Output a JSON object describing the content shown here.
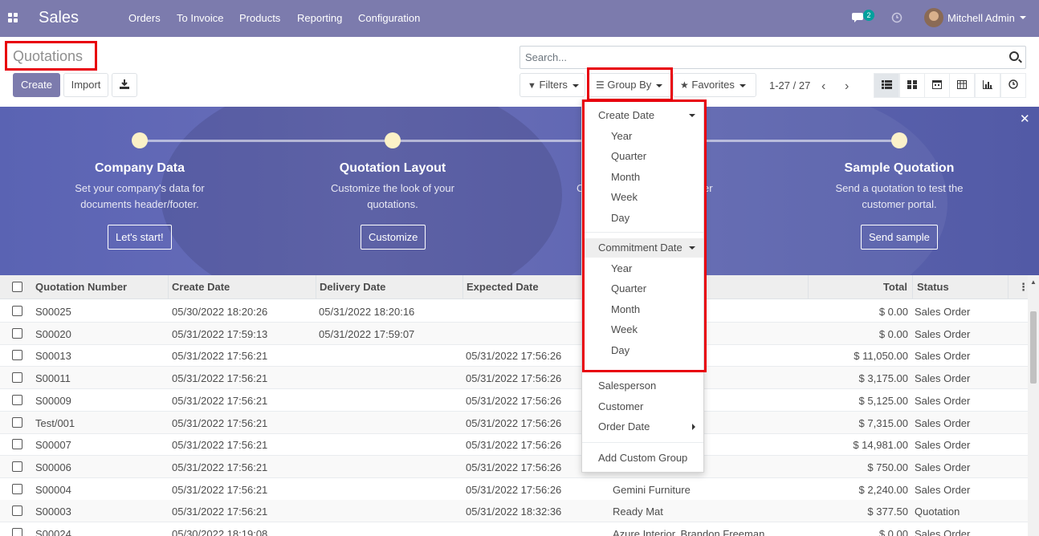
{
  "navbar": {
    "app_name": "Sales",
    "menu": [
      "Orders",
      "To Invoice",
      "Products",
      "Reporting",
      "Configuration"
    ],
    "messages_count": "2",
    "user_name": "Mitchell Admin"
  },
  "control_panel": {
    "title": "Quotations",
    "create_label": "Create",
    "import_label": "Import",
    "search_placeholder": "Search...",
    "filters_label": "Filters",
    "group_by_label": "Group By",
    "favorites_label": "Favorites",
    "pager": "1-27 / 27"
  },
  "banner": {
    "steps": [
      {
        "title": "Company Data",
        "desc1": "Set your company's data for",
        "desc2": "documents header/footer.",
        "button": "Let's start!"
      },
      {
        "title": "Quotation Layout",
        "desc1": "Customize the look of your",
        "desc2": "quotations.",
        "button": "Customize"
      },
      {
        "title": "",
        "desc1": "C",
        "desc2": "",
        "desc_tail": "er",
        "button": ""
      },
      {
        "title": "Sample Quotation",
        "desc1": "Send a quotation to test the",
        "desc2": "customer portal.",
        "button": "Send sample"
      }
    ]
  },
  "table": {
    "headers": [
      "Quotation Number",
      "Create Date",
      "Delivery Date",
      "Expected Date",
      "Total",
      "Status"
    ],
    "rows": [
      {
        "number": "S00025",
        "create": "05/30/2022 18:20:26",
        "delivery": "05/31/2022 18:20:16",
        "expected": "",
        "customer": "m Olson",
        "total": "$ 0.00",
        "status": "Sales Order"
      },
      {
        "number": "S00020",
        "create": "05/31/2022 17:59:13",
        "delivery": "05/31/2022 17:59:07",
        "expected": "",
        "customer": "don Freeman",
        "total": "$ 0.00",
        "status": "Sales Order"
      },
      {
        "number": "S00013",
        "create": "05/31/2022 17:56:21",
        "delivery": "",
        "expected": "05/31/2022 17:56:26",
        "customer": "",
        "total": "$ 11,050.00",
        "status": "Sales Order"
      },
      {
        "number": "S00011",
        "create": "05/31/2022 17:56:21",
        "delivery": "",
        "expected": "05/31/2022 17:56:26",
        "customer": "",
        "total": "$ 3,175.00",
        "status": "Sales Order"
      },
      {
        "number": "S00009",
        "create": "05/31/2022 17:56:21",
        "delivery": "",
        "expected": "05/31/2022 17:56:26",
        "customer": "",
        "total": "$ 5,125.00",
        "status": "Sales Order"
      },
      {
        "number": "Test/001",
        "create": "05/31/2022 17:56:21",
        "delivery": "",
        "expected": "05/31/2022 17:56:26",
        "customer": "",
        "total": "$ 7,315.00",
        "status": "Sales Order"
      },
      {
        "number": "S00007",
        "create": "05/31/2022 17:56:21",
        "delivery": "",
        "expected": "05/31/2022 17:56:26",
        "customer": "",
        "total": "$ 14,981.00",
        "status": "Sales Order"
      },
      {
        "number": "S00006",
        "create": "05/31/2022 17:56:21",
        "delivery": "",
        "expected": "05/31/2022 17:56:26",
        "customer": "",
        "total": "$ 750.00",
        "status": "Sales Order"
      },
      {
        "number": "S00004",
        "create": "05/31/2022 17:56:21",
        "delivery": "",
        "expected": "05/31/2022 17:56:26",
        "customer": "Gemini Furniture",
        "total": "$ 2,240.00",
        "status": "Sales Order"
      },
      {
        "number": "S00003",
        "create": "05/31/2022 17:56:21",
        "delivery": "",
        "expected": "05/31/2022 18:32:36",
        "customer": "Ready Mat",
        "total": "$ 377.50",
        "status": "Quotation"
      },
      {
        "number": "S00024",
        "create": "05/30/2022 18:19:08",
        "delivery": "",
        "expected": "",
        "customer": "Azure Interior, Brandon Freeman",
        "total": "$ 0.00",
        "status": "Sales Order"
      }
    ]
  },
  "group_by_menu": {
    "create_date": "Create Date",
    "create_date_options": [
      "Year",
      "Quarter",
      "Month",
      "Week",
      "Day"
    ],
    "commitment_date": "Commitment Date",
    "commitment_date_options": [
      "Year",
      "Quarter",
      "Month",
      "Week",
      "Day"
    ],
    "salesperson": "Salesperson",
    "customer": "Customer",
    "order_date": "Order Date",
    "add_custom_group": "Add Custom Group"
  },
  "colors": {
    "navbar": "#7c7bad",
    "primary": "#7c7bad",
    "highlight_box": "#e8000b",
    "banner": "#5e65b0"
  }
}
